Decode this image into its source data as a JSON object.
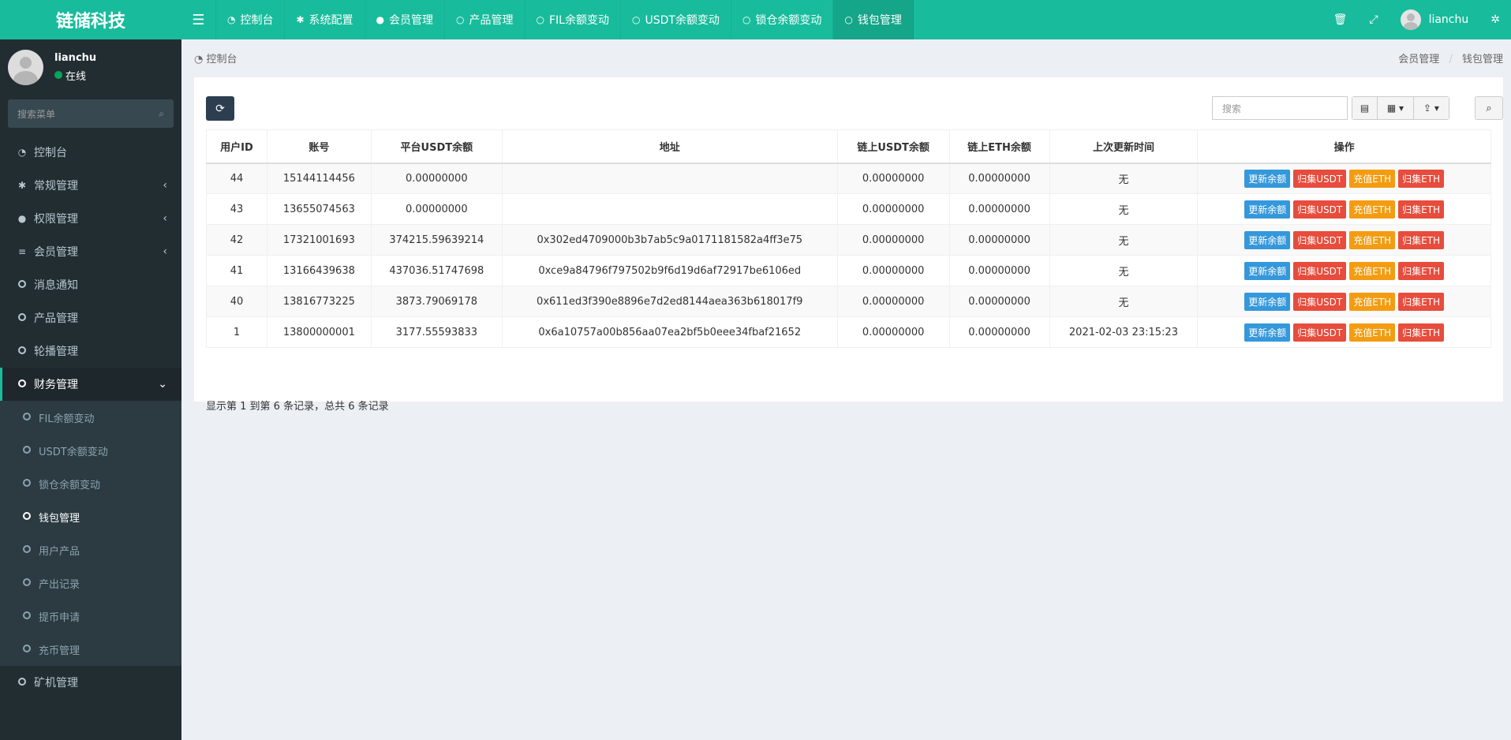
{
  "logo": "链储科技",
  "topnav": {
    "items": [
      {
        "label": "控制台",
        "icon": "dashboard-icon",
        "glyph": "◔"
      },
      {
        "label": "系统配置",
        "icon": "gear-icon",
        "glyph": "✱"
      },
      {
        "label": "会员管理",
        "icon": "user-icon",
        "glyph": "●"
      },
      {
        "label": "产品管理",
        "icon": "circle-icon",
        "glyph": "○"
      },
      {
        "label": "FIL余额变动",
        "icon": "circle-icon",
        "glyph": "○"
      },
      {
        "label": "USDT余额变动",
        "icon": "circle-icon",
        "glyph": "○"
      },
      {
        "label": "锁仓余额变动",
        "icon": "circle-icon",
        "glyph": "○"
      },
      {
        "label": "钱包管理",
        "icon": "circle-icon",
        "glyph": "○"
      }
    ],
    "active_index": 7,
    "username": "lianchu"
  },
  "sidebar": {
    "user": {
      "name": "lianchu",
      "status": "在线"
    },
    "search_placeholder": "搜索菜单",
    "items": [
      {
        "label": "控制台",
        "icon": "dashboard-icon",
        "glyph": "◔"
      },
      {
        "label": "常规管理",
        "icon": "cogs-icon",
        "glyph": "✱",
        "arrow": "‹"
      },
      {
        "label": "权限管理",
        "icon": "users-icon",
        "glyph": "●",
        "arrow": "‹"
      },
      {
        "label": "会员管理",
        "icon": "list-icon",
        "glyph": "≡",
        "arrow": "‹"
      },
      {
        "label": "消息通知",
        "icon": "circle-icon"
      },
      {
        "label": "产品管理",
        "icon": "circle-icon"
      },
      {
        "label": "轮播管理",
        "icon": "circle-icon"
      },
      {
        "label": "财务管理",
        "icon": "circle-icon",
        "arrow": "⌄"
      }
    ],
    "submenu": [
      {
        "label": "FIL余额变动"
      },
      {
        "label": "USDT余额变动"
      },
      {
        "label": "锁仓余额变动"
      },
      {
        "label": "钱包管理"
      },
      {
        "label": "用户产品"
      },
      {
        "label": "产出记录"
      },
      {
        "label": "提币申请"
      },
      {
        "label": "充币管理"
      }
    ],
    "submenu_active_index": 3,
    "last_item": {
      "label": "矿机管理",
      "icon": "circle-icon"
    }
  },
  "breadcrumb": {
    "left": "控制台",
    "right": [
      "会员管理",
      "钱包管理"
    ]
  },
  "toolbar": {
    "search_placeholder": "搜索"
  },
  "table": {
    "columns": [
      "用户ID",
      "账号",
      "平台USDT余额",
      "地址",
      "链上USDT余额",
      "链上ETH余额",
      "上次更新时间",
      "操作"
    ],
    "rows": [
      [
        "44",
        "15144114456",
        "0.00000000",
        "",
        "0.00000000",
        "0.00000000",
        "无"
      ],
      [
        "43",
        "13655074563",
        "0.00000000",
        "",
        "0.00000000",
        "0.00000000",
        "无"
      ],
      [
        "42",
        "17321001693",
        "374215.59639214",
        "0x302ed4709000b3b7ab5c9a0171181582a4ff3e75",
        "0.00000000",
        "0.00000000",
        "无"
      ],
      [
        "41",
        "13166439638",
        "437036.51747698",
        "0xce9a84796f797502b9f6d19d6af72917be6106ed",
        "0.00000000",
        "0.00000000",
        "无"
      ],
      [
        "40",
        "13816773225",
        "3873.79069178",
        "0x611ed3f390e8896e7d2ed8144aea363b618017f9",
        "0.00000000",
        "0.00000000",
        "无"
      ],
      [
        "1",
        "13800000001",
        "3177.55593833",
        "0x6a10757a00b856aa07ea2bf5b0eee34fbaf21652",
        "0.00000000",
        "0.00000000",
        "2021-02-03 23:15:23"
      ]
    ],
    "actions": [
      {
        "label": "更新余额",
        "color": "#3498db"
      },
      {
        "label": "归集USDT",
        "color": "#e74c3c"
      },
      {
        "label": "充值ETH",
        "color": "#f39c12"
      },
      {
        "label": "归集ETH",
        "color": "#e74c3c"
      }
    ]
  },
  "pagination": "显示第 1 到第 6 条记录，总共 6 条记录",
  "colors": {
    "brand": "#18bc9c",
    "sidebar": "#222d32",
    "refresh_button": "#2c3e50"
  }
}
